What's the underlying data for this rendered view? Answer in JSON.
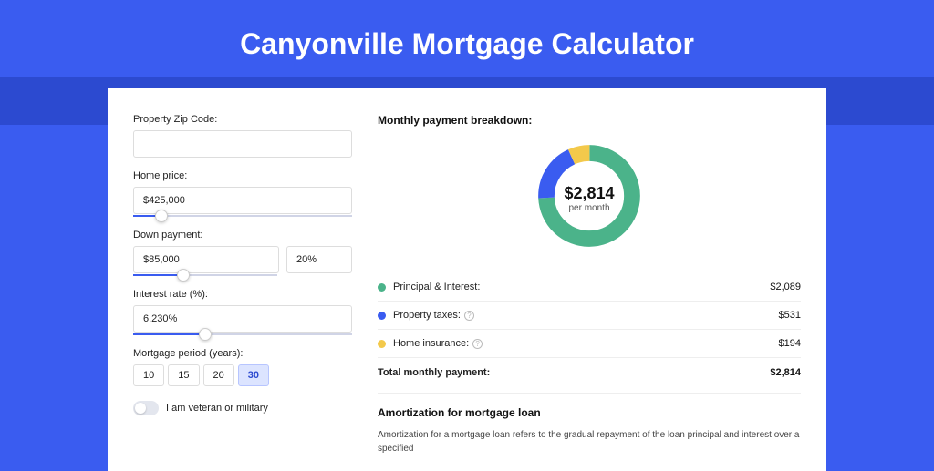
{
  "header": {
    "title": "Canyonville Mortgage Calculator"
  },
  "form": {
    "zip_label": "Property Zip Code:",
    "zip_value": "",
    "home_price_label": "Home price:",
    "home_price_value": "$425,000",
    "down_payment_label": "Down payment:",
    "down_payment_value": "$85,000",
    "down_payment_pct": "20%",
    "interest_label": "Interest rate (%):",
    "interest_value": "6.230%",
    "period_label": "Mortgage period (years):",
    "periods": [
      "10",
      "15",
      "20",
      "30"
    ],
    "period_active": "30",
    "veteran_label": "I am veteran or military"
  },
  "breakdown": {
    "title": "Monthly payment breakdown:",
    "center_amount": "$2,814",
    "center_sub": "per month",
    "items": [
      {
        "label": "Principal & Interest:",
        "value": "$2,089",
        "color": "#4bb38a",
        "info": false
      },
      {
        "label": "Property taxes:",
        "value": "$531",
        "color": "#3a5cf0",
        "info": true
      },
      {
        "label": "Home insurance:",
        "value": "$194",
        "color": "#f3c94b",
        "info": true
      }
    ],
    "total_label": "Total monthly payment:",
    "total_value": "$2,814"
  },
  "amort": {
    "title": "Amortization for mortgage loan",
    "text": "Amortization for a mortgage loan refers to the gradual repayment of the loan principal and interest over a specified"
  },
  "chart_data": {
    "type": "pie",
    "title": "Monthly payment breakdown",
    "series": [
      {
        "name": "Principal & Interest",
        "value": 2089,
        "color": "#4bb38a"
      },
      {
        "name": "Property taxes",
        "value": 531,
        "color": "#3a5cf0"
      },
      {
        "name": "Home insurance",
        "value": 194,
        "color": "#f3c94b"
      }
    ],
    "total": 2814
  }
}
